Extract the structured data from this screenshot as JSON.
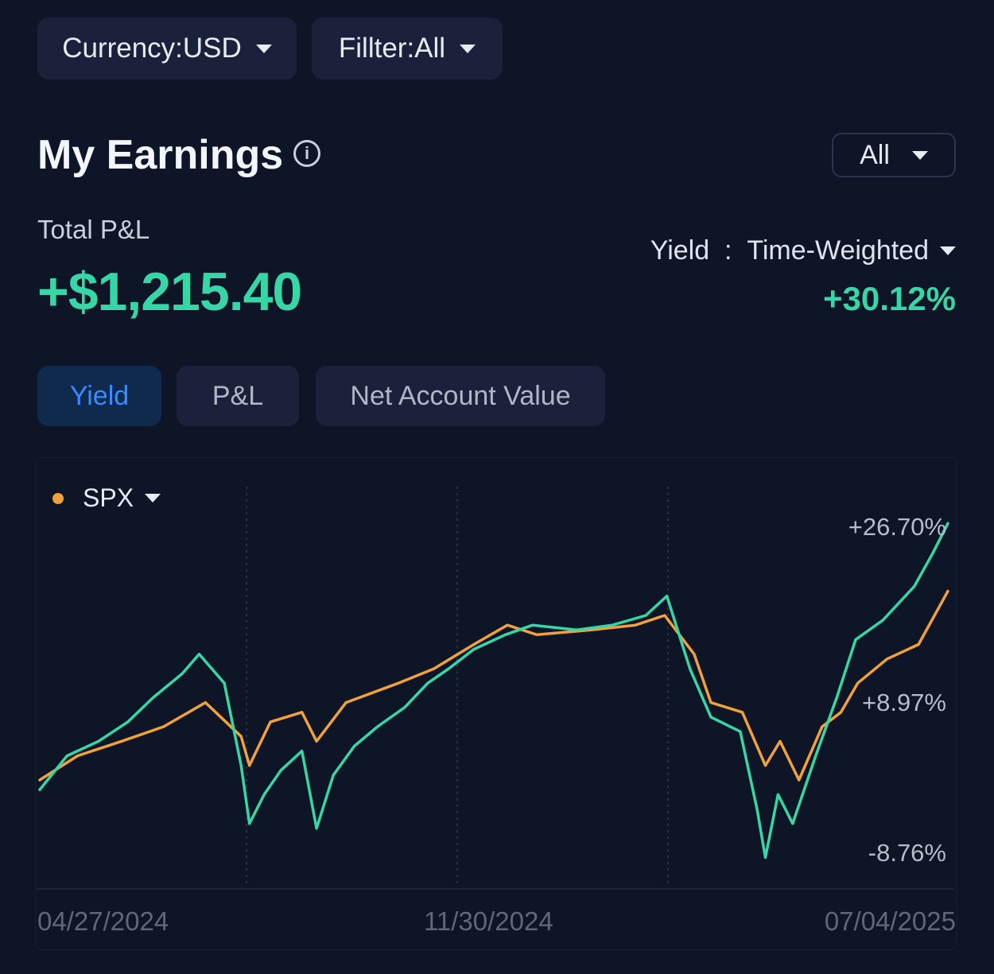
{
  "filters": {
    "currency_label": "Currency:USD",
    "filter_label": "Fillter:All"
  },
  "header": {
    "title": "My Earnings",
    "range_label": "All"
  },
  "summary": {
    "total_label": "Total P&L",
    "total_value": "+$1,215.40",
    "yield_label": "Yield  :  Time-Weighted",
    "yield_value": "+30.12%"
  },
  "tabs": [
    {
      "label": "Yield",
      "active": true
    },
    {
      "label": "P&L",
      "active": false
    },
    {
      "label": "Net Account Value",
      "active": false
    }
  ],
  "colors": {
    "portfolio": "#36d6a6",
    "benchmark": "#f0a13a",
    "accent_blue": "#3a8bff"
  },
  "chart_data": {
    "type": "line",
    "legend": "SPX",
    "y_tick_labels": [
      "+26.70%",
      "+8.97%",
      "-8.76%"
    ],
    "y_ticks": [
      26.7,
      8.97,
      -8.76
    ],
    "x_tick_labels": [
      "04/27/2024",
      "11/30/2024",
      "07/04/2025"
    ],
    "ylim": [
      -10.5,
      28.5
    ],
    "x_range": [
      "2024-04-27",
      "2025-07-04"
    ],
    "series": [
      {
        "role": "portfolio",
        "color": "#36d6a6",
        "points": [
          [
            "2024-04-27",
            -0.5
          ],
          [
            "2024-05-10",
            3.0
          ],
          [
            "2024-05-25",
            4.5
          ],
          [
            "2024-06-08",
            6.5
          ],
          [
            "2024-06-20",
            9.0
          ],
          [
            "2024-07-04",
            11.5
          ],
          [
            "2024-07-12",
            13.5
          ],
          [
            "2024-07-24",
            10.5
          ],
          [
            "2024-08-01",
            2.0
          ],
          [
            "2024-08-05",
            -4.0
          ],
          [
            "2024-08-12",
            -1.0
          ],
          [
            "2024-08-20",
            1.5
          ],
          [
            "2024-08-30",
            3.5
          ],
          [
            "2024-09-06",
            -4.5
          ],
          [
            "2024-09-14",
            1.0
          ],
          [
            "2024-09-24",
            4.0
          ],
          [
            "2024-10-05",
            6.0
          ],
          [
            "2024-10-18",
            8.0
          ],
          [
            "2024-10-29",
            10.5
          ],
          [
            "2024-11-08",
            12.0
          ],
          [
            "2024-11-20",
            14.0
          ],
          [
            "2024-12-05",
            15.5
          ],
          [
            "2024-12-18",
            16.5
          ],
          [
            "2025-01-08",
            16.0
          ],
          [
            "2025-01-25",
            16.5
          ],
          [
            "2025-02-10",
            17.5
          ],
          [
            "2025-02-20",
            19.5
          ],
          [
            "2025-03-03",
            12.0
          ],
          [
            "2025-03-13",
            7.0
          ],
          [
            "2025-03-27",
            5.5
          ],
          [
            "2025-04-04",
            -2.5
          ],
          [
            "2025-04-08",
            -7.5
          ],
          [
            "2025-04-14",
            -1.0
          ],
          [
            "2025-04-21",
            -4.0
          ],
          [
            "2025-05-02",
            3.0
          ],
          [
            "2025-05-12",
            9.0
          ],
          [
            "2025-05-21",
            15.0
          ],
          [
            "2025-06-03",
            17.0
          ],
          [
            "2025-06-18",
            20.5
          ],
          [
            "2025-06-27",
            24.0
          ],
          [
            "2025-07-04",
            27.0
          ]
        ]
      },
      {
        "role": "benchmark",
        "color": "#f0a13a",
        "points": [
          [
            "2024-04-27",
            0.5
          ],
          [
            "2024-05-15",
            3.0
          ],
          [
            "2024-06-05",
            4.5
          ],
          [
            "2024-06-25",
            6.0
          ],
          [
            "2024-07-15",
            8.5
          ],
          [
            "2024-08-01",
            5.0
          ],
          [
            "2024-08-05",
            2.0
          ],
          [
            "2024-08-15",
            6.5
          ],
          [
            "2024-08-30",
            7.5
          ],
          [
            "2024-09-06",
            4.5
          ],
          [
            "2024-09-20",
            8.5
          ],
          [
            "2024-10-15",
            10.5
          ],
          [
            "2024-11-01",
            12.0
          ],
          [
            "2024-11-20",
            14.5
          ],
          [
            "2024-12-06",
            16.5
          ],
          [
            "2024-12-20",
            15.5
          ],
          [
            "2025-01-15",
            16.0
          ],
          [
            "2025-02-05",
            16.5
          ],
          [
            "2025-02-19",
            17.5
          ],
          [
            "2025-03-05",
            13.5
          ],
          [
            "2025-03-13",
            8.5
          ],
          [
            "2025-03-28",
            7.5
          ],
          [
            "2025-04-08",
            2.0
          ],
          [
            "2025-04-15",
            4.5
          ],
          [
            "2025-04-24",
            0.5
          ],
          [
            "2025-05-05",
            6.0
          ],
          [
            "2025-05-14",
            7.5
          ],
          [
            "2025-05-22",
            10.5
          ],
          [
            "2025-06-05",
            13.0
          ],
          [
            "2025-06-20",
            14.5
          ],
          [
            "2025-07-04",
            20.0
          ]
        ]
      }
    ]
  }
}
